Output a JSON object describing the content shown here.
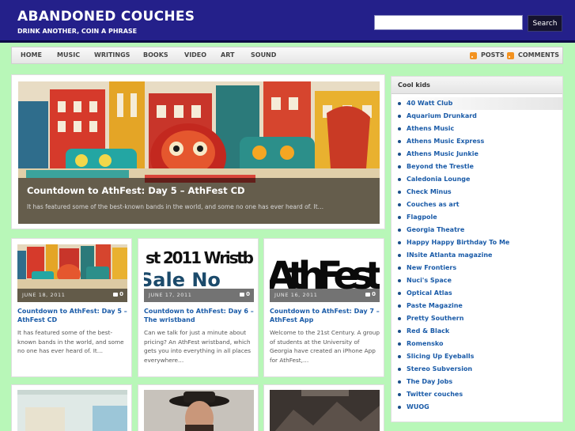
{
  "header": {
    "site_title": "ABANDONED COUCHES",
    "tagline": "DRINK ANOTHER, COIN A PHRASE",
    "search_placeholder": "",
    "search_button": "Search"
  },
  "nav": {
    "items": [
      "HOME",
      "MUSIC",
      "WRITINGS",
      "BOOKS",
      "VIDEO",
      "ART",
      "SOUND"
    ],
    "posts_feed": "POSTS",
    "comments_feed": "COMMENTS"
  },
  "feature": {
    "title": "Countdown to AthFest: Day 5 – AthFest CD",
    "excerpt": "It has featured some of the best-known bands in the world, and some no one has ever heard of. It…"
  },
  "posts": [
    {
      "date": "JUNE 18, 2011",
      "comments": "0",
      "title": "Countdown to AthFest: Day 5 – AthFest CD",
      "excerpt": "It has featured some of the best-known bands in the world, and some no one has ever heard of. It…"
    },
    {
      "date": "JUNE 17, 2011",
      "comments": "0",
      "title": "Countdown to AthFest: Day 6 – The wristband",
      "excerpt": "Can we talk for just a minute about pricing? An AthFest wristband, which gets you into everything in all places everywhere…"
    },
    {
      "date": "JUNE 16, 2011",
      "comments": "0",
      "title": "Countdown to AthFest: Day 7 – AthFest App",
      "excerpt": "Welcome to the 21st Century. A group of students at the University of Georgia have created an iPhone App for AthFest,…"
    }
  ],
  "thumb_text": {
    "wristband_top": "st 2011 Wristb",
    "wristband_bottom": "Sale No",
    "app": "AthFest"
  },
  "sidebar": {
    "title": "Cool kids",
    "links": [
      "40 Watt Club",
      "Aquarium Drunkard",
      "Athens Music",
      "Athens Music Express",
      "Athens Music Junkie",
      "Beyond the Trestle",
      "Caledonia Lounge",
      "Check Minus",
      "Couches as art",
      "Flagpole",
      "Georgia Theatre",
      "Happy Happy Birthday To Me",
      "INsite Atlanta magazine",
      "New Frontiers",
      "Nuci's Space",
      "Optical Atlas",
      "Paste Magazine",
      "Pretty Southern",
      "Red & Black",
      "Romensko",
      "Slicing Up Eyeballs",
      "Stereo Subversion",
      "The Day Jobs",
      "Twitter couches",
      "WUOG"
    ]
  },
  "colors": {
    "header_bg": "#24208a",
    "page_bg": "#b8f7b8",
    "link": "#1a5ba8",
    "rss": "#f39220"
  }
}
